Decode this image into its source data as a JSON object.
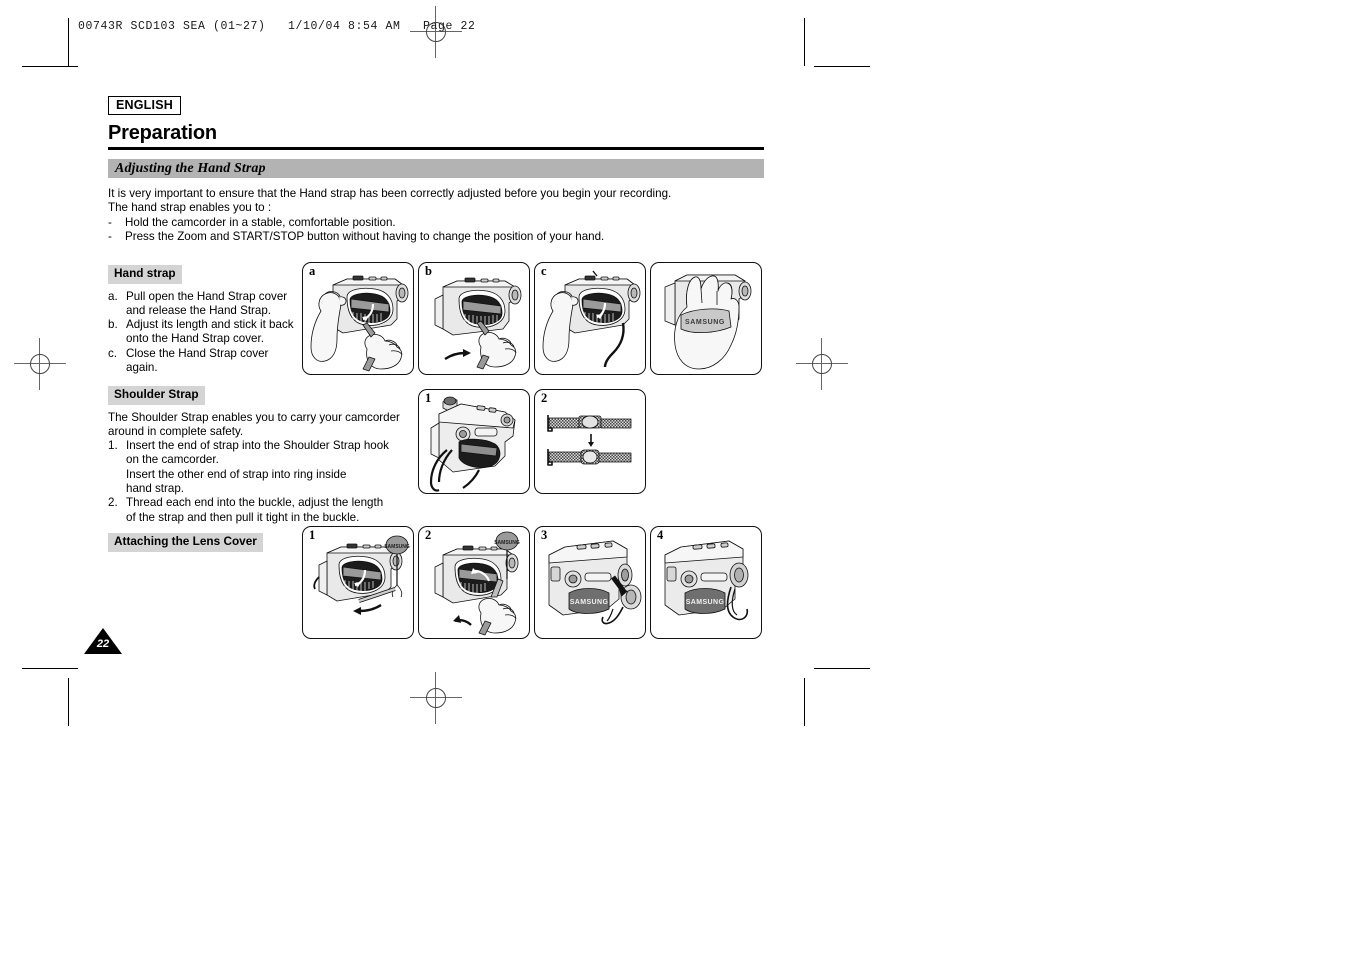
{
  "printer_slug": "00743R SCD103 SEA (01~27)   1/10/04 8:54 AM   Page 22",
  "header": {
    "language_badge": "ENGLISH",
    "title": "Preparation"
  },
  "section": {
    "bar_title": "Adjusting the Hand Strap",
    "intro_line_1": "It is very important to ensure that the Hand strap has been correctly adjusted before you begin your recording.",
    "intro_line_2": "The hand strap enables you to :",
    "dash": "-",
    "bullets": [
      "Hold the camcorder in a stable, comfortable position.",
      "Press the Zoom and START/STOP button without having to change the position of your hand."
    ]
  },
  "hand_strap": {
    "tag": "Hand strap",
    "steps": [
      {
        "label": "a.",
        "text": "Pull open the Hand Strap cover",
        "cont": "and release the Hand Strap."
      },
      {
        "label": "b.",
        "text": "Adjust its length and stick it back",
        "cont": "onto the Hand Strap cover."
      },
      {
        "label": "c.",
        "text": "Close the Hand Strap cover",
        "cont": "again."
      }
    ],
    "figures": [
      {
        "num": "a",
        "alt": "hand pulling open hand strap cover on camcorder"
      },
      {
        "num": "b",
        "alt": "hand adjusting hand strap length"
      },
      {
        "num": "c",
        "alt": "hand closing the hand strap cover"
      },
      {
        "num": "",
        "alt": "hand gripping camcorder through SAMSUNG hand strap"
      }
    ],
    "strap_brand": "SAMSUNG"
  },
  "shoulder_strap": {
    "tag": "Shoulder Strap",
    "intro_line_1": "The Shoulder Strap enables you to carry your camcorder",
    "intro_line_2": "around in complete safety.",
    "steps": [
      {
        "label": "1.",
        "text": "Insert the end of strap into the Shoulder Strap hook",
        "cont": "on the camcorder.",
        "cont2": "Insert the other end of strap into ring inside",
        "cont3": "hand strap."
      },
      {
        "label": "2.",
        "text": "Thread each end into the buckle, adjust the length",
        "cont": "of the strap and then pull it tight in the buckle."
      }
    ],
    "figures": [
      {
        "num": "1",
        "alt": "camcorder with shoulder strap attached to hook"
      },
      {
        "num": "2",
        "alt": "strap threaded through buckle, arrow showing tightening"
      }
    ]
  },
  "lens_cover": {
    "tag": "Attaching the Lens Cover",
    "figures": [
      {
        "num": "1",
        "alt": "lens cover cord being routed into hand strap ring"
      },
      {
        "num": "2",
        "alt": "hand pulling lens cover cord through hand strap"
      },
      {
        "num": "3",
        "alt": "lens cover being attached to camcorder lens"
      },
      {
        "num": "4",
        "alt": "camcorder with lens cover in place"
      }
    ],
    "strap_brand": "SAMSUNG"
  },
  "footer": {
    "page_number": "22"
  },
  "colors": {
    "section_bar_gray": "#b3b3b3",
    "tag_gray": "#d4d4d4",
    "ink": "#000000"
  }
}
